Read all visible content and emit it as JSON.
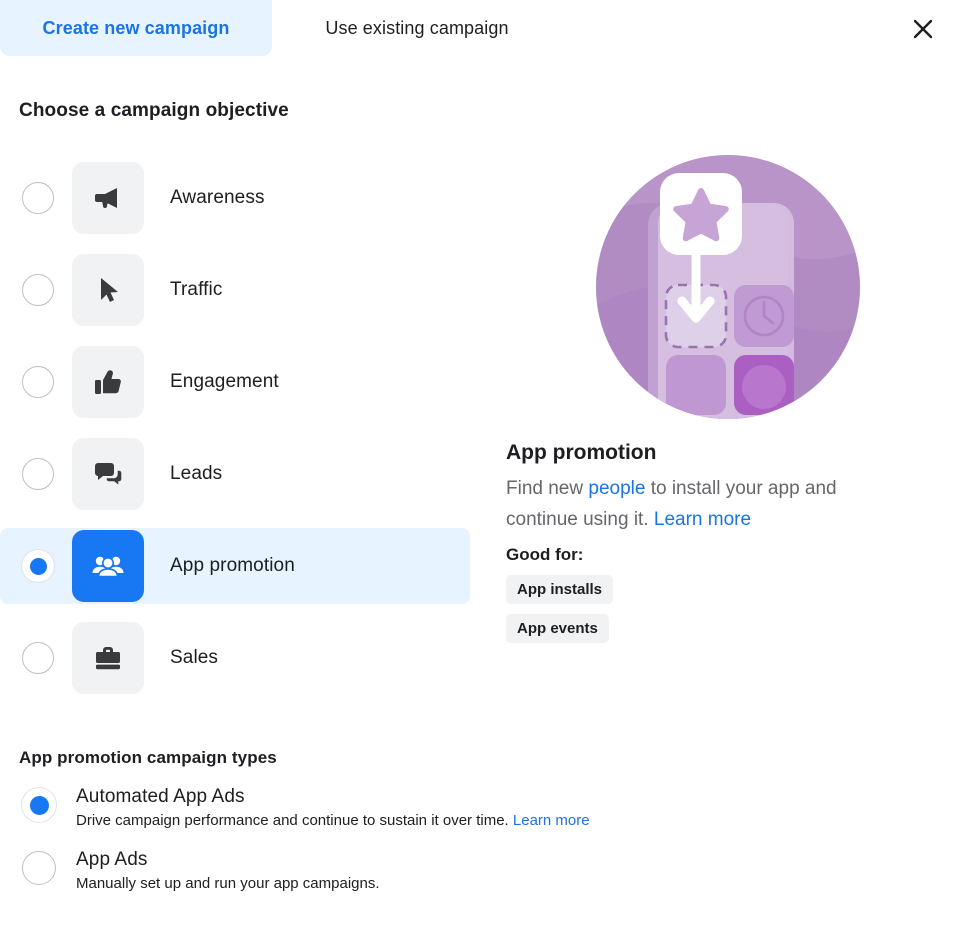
{
  "tabs": [
    {
      "id": "create-new",
      "label": "Create new campaign",
      "active": true
    },
    {
      "id": "use-existing",
      "label": "Use existing campaign",
      "active": false
    }
  ],
  "close_icon": "close-icon",
  "objective_section": {
    "title": "Choose a campaign objective",
    "options": [
      {
        "id": "awareness",
        "label": "Awareness",
        "icon": "megaphone-icon",
        "selected": false
      },
      {
        "id": "traffic",
        "label": "Traffic",
        "icon": "cursor-icon",
        "selected": false
      },
      {
        "id": "engagement",
        "label": "Engagement",
        "icon": "thumbs-up-icon",
        "selected": false
      },
      {
        "id": "leads",
        "label": "Leads",
        "icon": "speech-bubbles-icon",
        "selected": false
      },
      {
        "id": "app-promotion",
        "label": "App promotion",
        "icon": "people-group-icon",
        "selected": true
      },
      {
        "id": "sales",
        "label": "Sales",
        "icon": "briefcase-icon",
        "selected": false
      }
    ]
  },
  "detail": {
    "illustration": "app-install-illustration",
    "title": "App promotion",
    "description_part1": "Find new ",
    "description_link1": "people",
    "description_part2": " to install your app and continue using it. ",
    "description_link2": "Learn more",
    "good_for_label": "Good for:",
    "tags": [
      "App installs",
      "App events"
    ]
  },
  "campaign_types": {
    "title": "App promotion campaign types",
    "options": [
      {
        "id": "automated-app-ads",
        "label": "Automated App Ads",
        "description": "Drive campaign performance and continue to sustain it over time. ",
        "link": "Learn more",
        "selected": true
      },
      {
        "id": "app-ads",
        "label": "App Ads",
        "description": "Manually set up and run your app campaigns.",
        "link": "",
        "selected": false
      }
    ]
  },
  "colors": {
    "accent_blue": "#1877f2",
    "link_blue": "#1b74e4",
    "selected_row_bg": "#e7f3ff",
    "tile_grey": "#f1f2f3",
    "text_primary": "#1c1e21",
    "text_secondary": "#65676b",
    "illustration_purple": "#b894c8"
  }
}
